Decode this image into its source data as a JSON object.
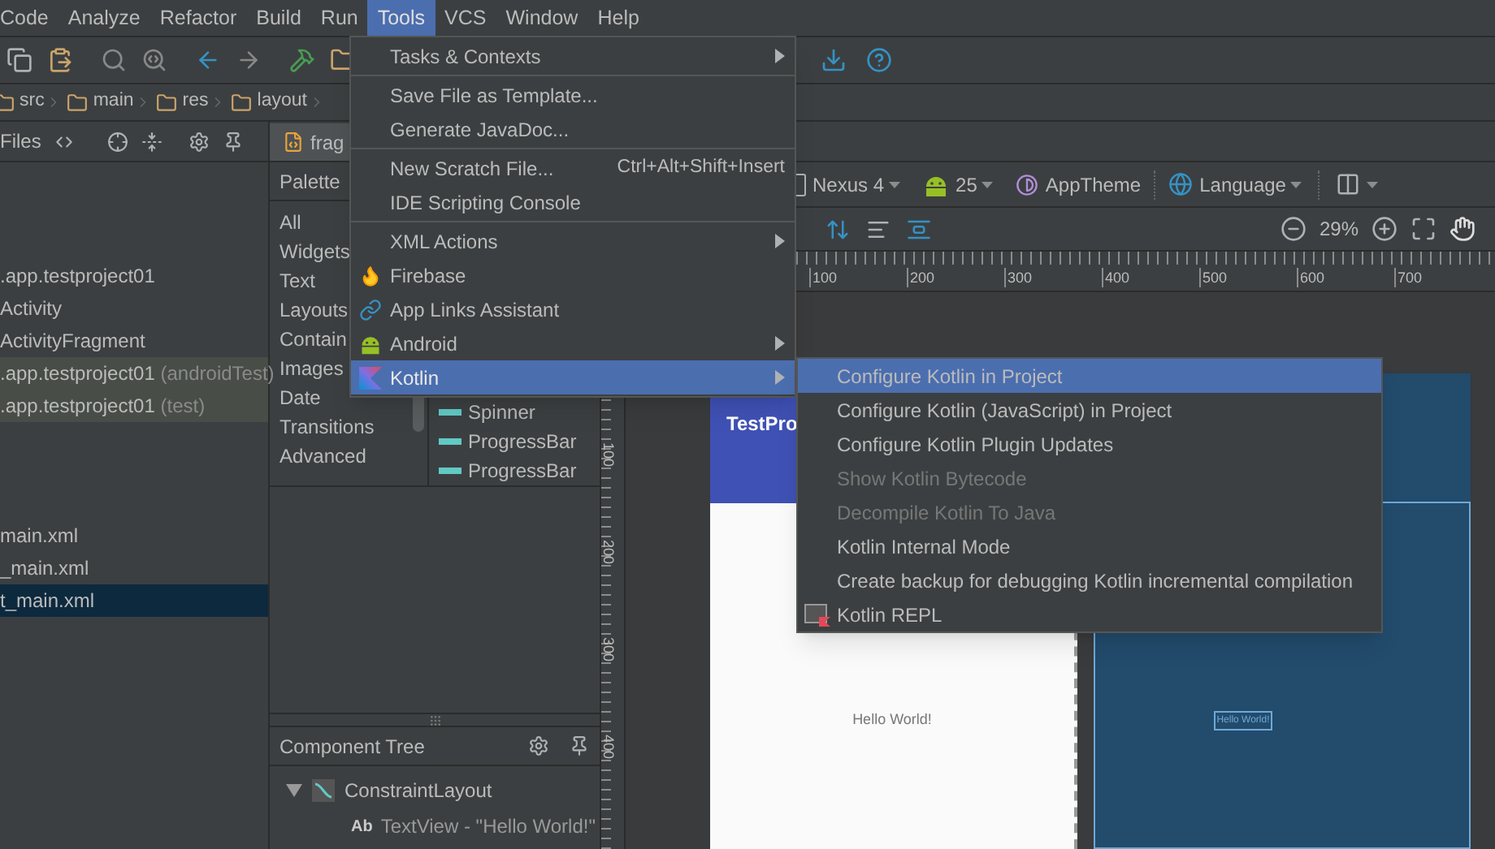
{
  "menu_bar": [
    {
      "label": "Code",
      "selected": false
    },
    {
      "label": "Analyze",
      "selected": false
    },
    {
      "label": "Refactor",
      "selected": false
    },
    {
      "label": "Build",
      "selected": false
    },
    {
      "label": "Run",
      "selected": false
    },
    {
      "label": "Tools",
      "selected": true
    },
    {
      "label": "VCS",
      "selected": false
    },
    {
      "label": "Window",
      "selected": false
    },
    {
      "label": "Help",
      "selected": false
    }
  ],
  "breadcrumb": [
    "src",
    "main",
    "res",
    "layout"
  ],
  "project_panel": {
    "title": "Files",
    "sources": [
      {
        "label": ".app.testproject01",
        "test": false,
        "selected": false
      },
      {
        "label": "Activity",
        "test": false,
        "selected": false
      },
      {
        "label": "ActivityFragment",
        "test": false,
        "selected": false
      },
      {
        "label": ".app.testproject01",
        "note": "(androidTest)",
        "test": true,
        "selected": false
      },
      {
        "label": ".app.testproject01",
        "note": "(test)",
        "test": true,
        "selected": false
      }
    ],
    "layouts": [
      {
        "label": "main.xml",
        "selected": false
      },
      {
        "label": "_main.xml",
        "selected": false
      },
      {
        "label": "t_main.xml",
        "selected": true
      }
    ]
  },
  "editor_tab": {
    "label": "frag"
  },
  "palette": {
    "title": "Palette",
    "categories": [
      "All",
      "Widgets",
      "Text",
      "Layouts",
      "Contain",
      "Images",
      "Date",
      "Transitions",
      "Advanced"
    ],
    "widgets": [
      "Spinner",
      "ProgressBar",
      "ProgressBar"
    ]
  },
  "component_tree": {
    "title": "Component Tree",
    "items": [
      {
        "label": "ConstraintLayout",
        "expanded": true,
        "children": [
          {
            "badge": "Ab",
            "label": "TextView - \"Hello World!\""
          }
        ]
      }
    ]
  },
  "design_toolbar": {
    "device": "Nexus 4",
    "api": "25",
    "theme": "AppTheme",
    "language": "Language",
    "zoom": "29%"
  },
  "rulers": {
    "horizontal": [
      "100",
      "200",
      "300",
      "400",
      "500",
      "600",
      "700"
    ],
    "vertical": [
      "100",
      "200",
      "300",
      "400"
    ]
  },
  "preview": {
    "app_title": "TestPro",
    "text": "Hello World!"
  },
  "blueprint": {
    "text": "Hello World!"
  },
  "tools_menu": {
    "groups": [
      [
        {
          "label": "Tasks & Contexts",
          "submenu": true,
          "selected": false
        }
      ],
      [
        {
          "label": "Save File as Template...",
          "submenu": false,
          "selected": false
        },
        {
          "label": "Generate JavaDoc...",
          "submenu": false,
          "selected": false
        }
      ],
      [
        {
          "label": "New Scratch File...",
          "shortcut": "Ctrl+Alt+Shift+Insert",
          "submenu": false,
          "selected": false
        },
        {
          "label": "IDE Scripting Console",
          "submenu": false,
          "selected": false
        }
      ],
      [
        {
          "label": "XML Actions",
          "submenu": true,
          "selected": false
        },
        {
          "label": "Firebase",
          "submenu": false,
          "selected": false
        },
        {
          "label": "App Links Assistant",
          "submenu": false,
          "selected": false
        },
        {
          "label": "Android",
          "submenu": true,
          "selected": false
        },
        {
          "label": "Kotlin",
          "submenu": true,
          "selected": true
        }
      ]
    ]
  },
  "kotlin_menu": {
    "items": [
      {
        "label": "Configure Kotlin in Project",
        "selected": true,
        "disabled": false
      },
      {
        "label": "Configure Kotlin (JavaScript) in Project",
        "selected": false,
        "disabled": false
      },
      {
        "label": "Configure Kotlin Plugin Updates",
        "selected": false,
        "disabled": false
      },
      {
        "label": "Show Kotlin Bytecode",
        "selected": false,
        "disabled": true
      },
      {
        "label": "Decompile Kotlin To Java",
        "selected": false,
        "disabled": true
      },
      {
        "label": "Kotlin Internal Mode",
        "selected": false,
        "disabled": false
      },
      {
        "label": "Create backup for debugging Kotlin incremental compilation",
        "selected": false,
        "disabled": false
      },
      {
        "label": "Kotlin REPL",
        "selected": false,
        "disabled": false
      }
    ]
  }
}
